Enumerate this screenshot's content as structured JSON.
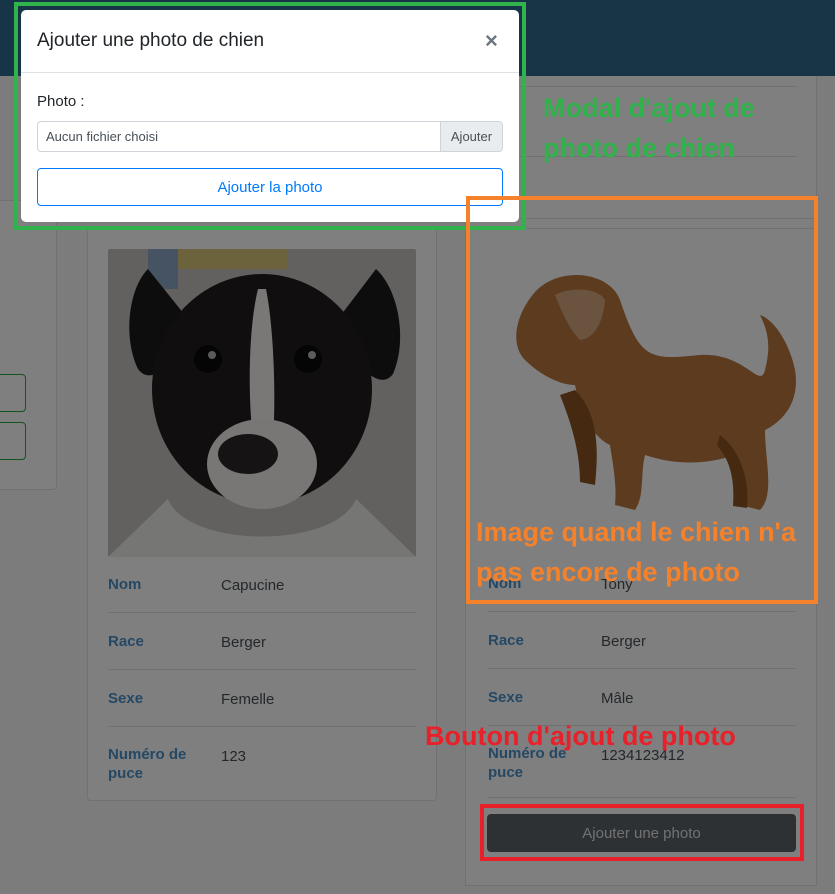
{
  "modal": {
    "title": "Ajouter une photo de chien",
    "close_symbol": "×",
    "photo_label": "Photo :",
    "file_placeholder": "Aucun fichier choisi",
    "browse_label": "Ajouter",
    "submit_label": "Ajouter la photo"
  },
  "dogs": [
    {
      "fields": [
        {
          "label": "Nom",
          "value": "Capucine"
        },
        {
          "label": "Race",
          "value": "Berger"
        },
        {
          "label": "Sexe",
          "value": "Femelle"
        },
        {
          "label": "Numéro de puce",
          "value": "123"
        }
      ]
    },
    {
      "fields": [
        {
          "label": "Nom",
          "value": "Tony"
        },
        {
          "label": "Race",
          "value": "Berger"
        },
        {
          "label": "Sexe",
          "value": "Mâle"
        },
        {
          "label": "Numéro de puce",
          "value": "1234123412"
        }
      ],
      "add_photo_label": "Ajouter une photo"
    }
  ],
  "annotations": {
    "modal": "Modal d'ajout de photo de chien",
    "placeholder_image": "Image quand le chien n'a pas encore de photo",
    "add_photo_button": "Bouton d'ajout de photo"
  },
  "colors": {
    "annotation_green": "#2fb34a",
    "annotation_orange": "#f5822a",
    "annotation_red": "#e8202a",
    "primary": "#007bff",
    "header": "#2f6a8d"
  },
  "icons": [
    "close-icon",
    "dog-placeholder-icon",
    "puppy-photo"
  ]
}
